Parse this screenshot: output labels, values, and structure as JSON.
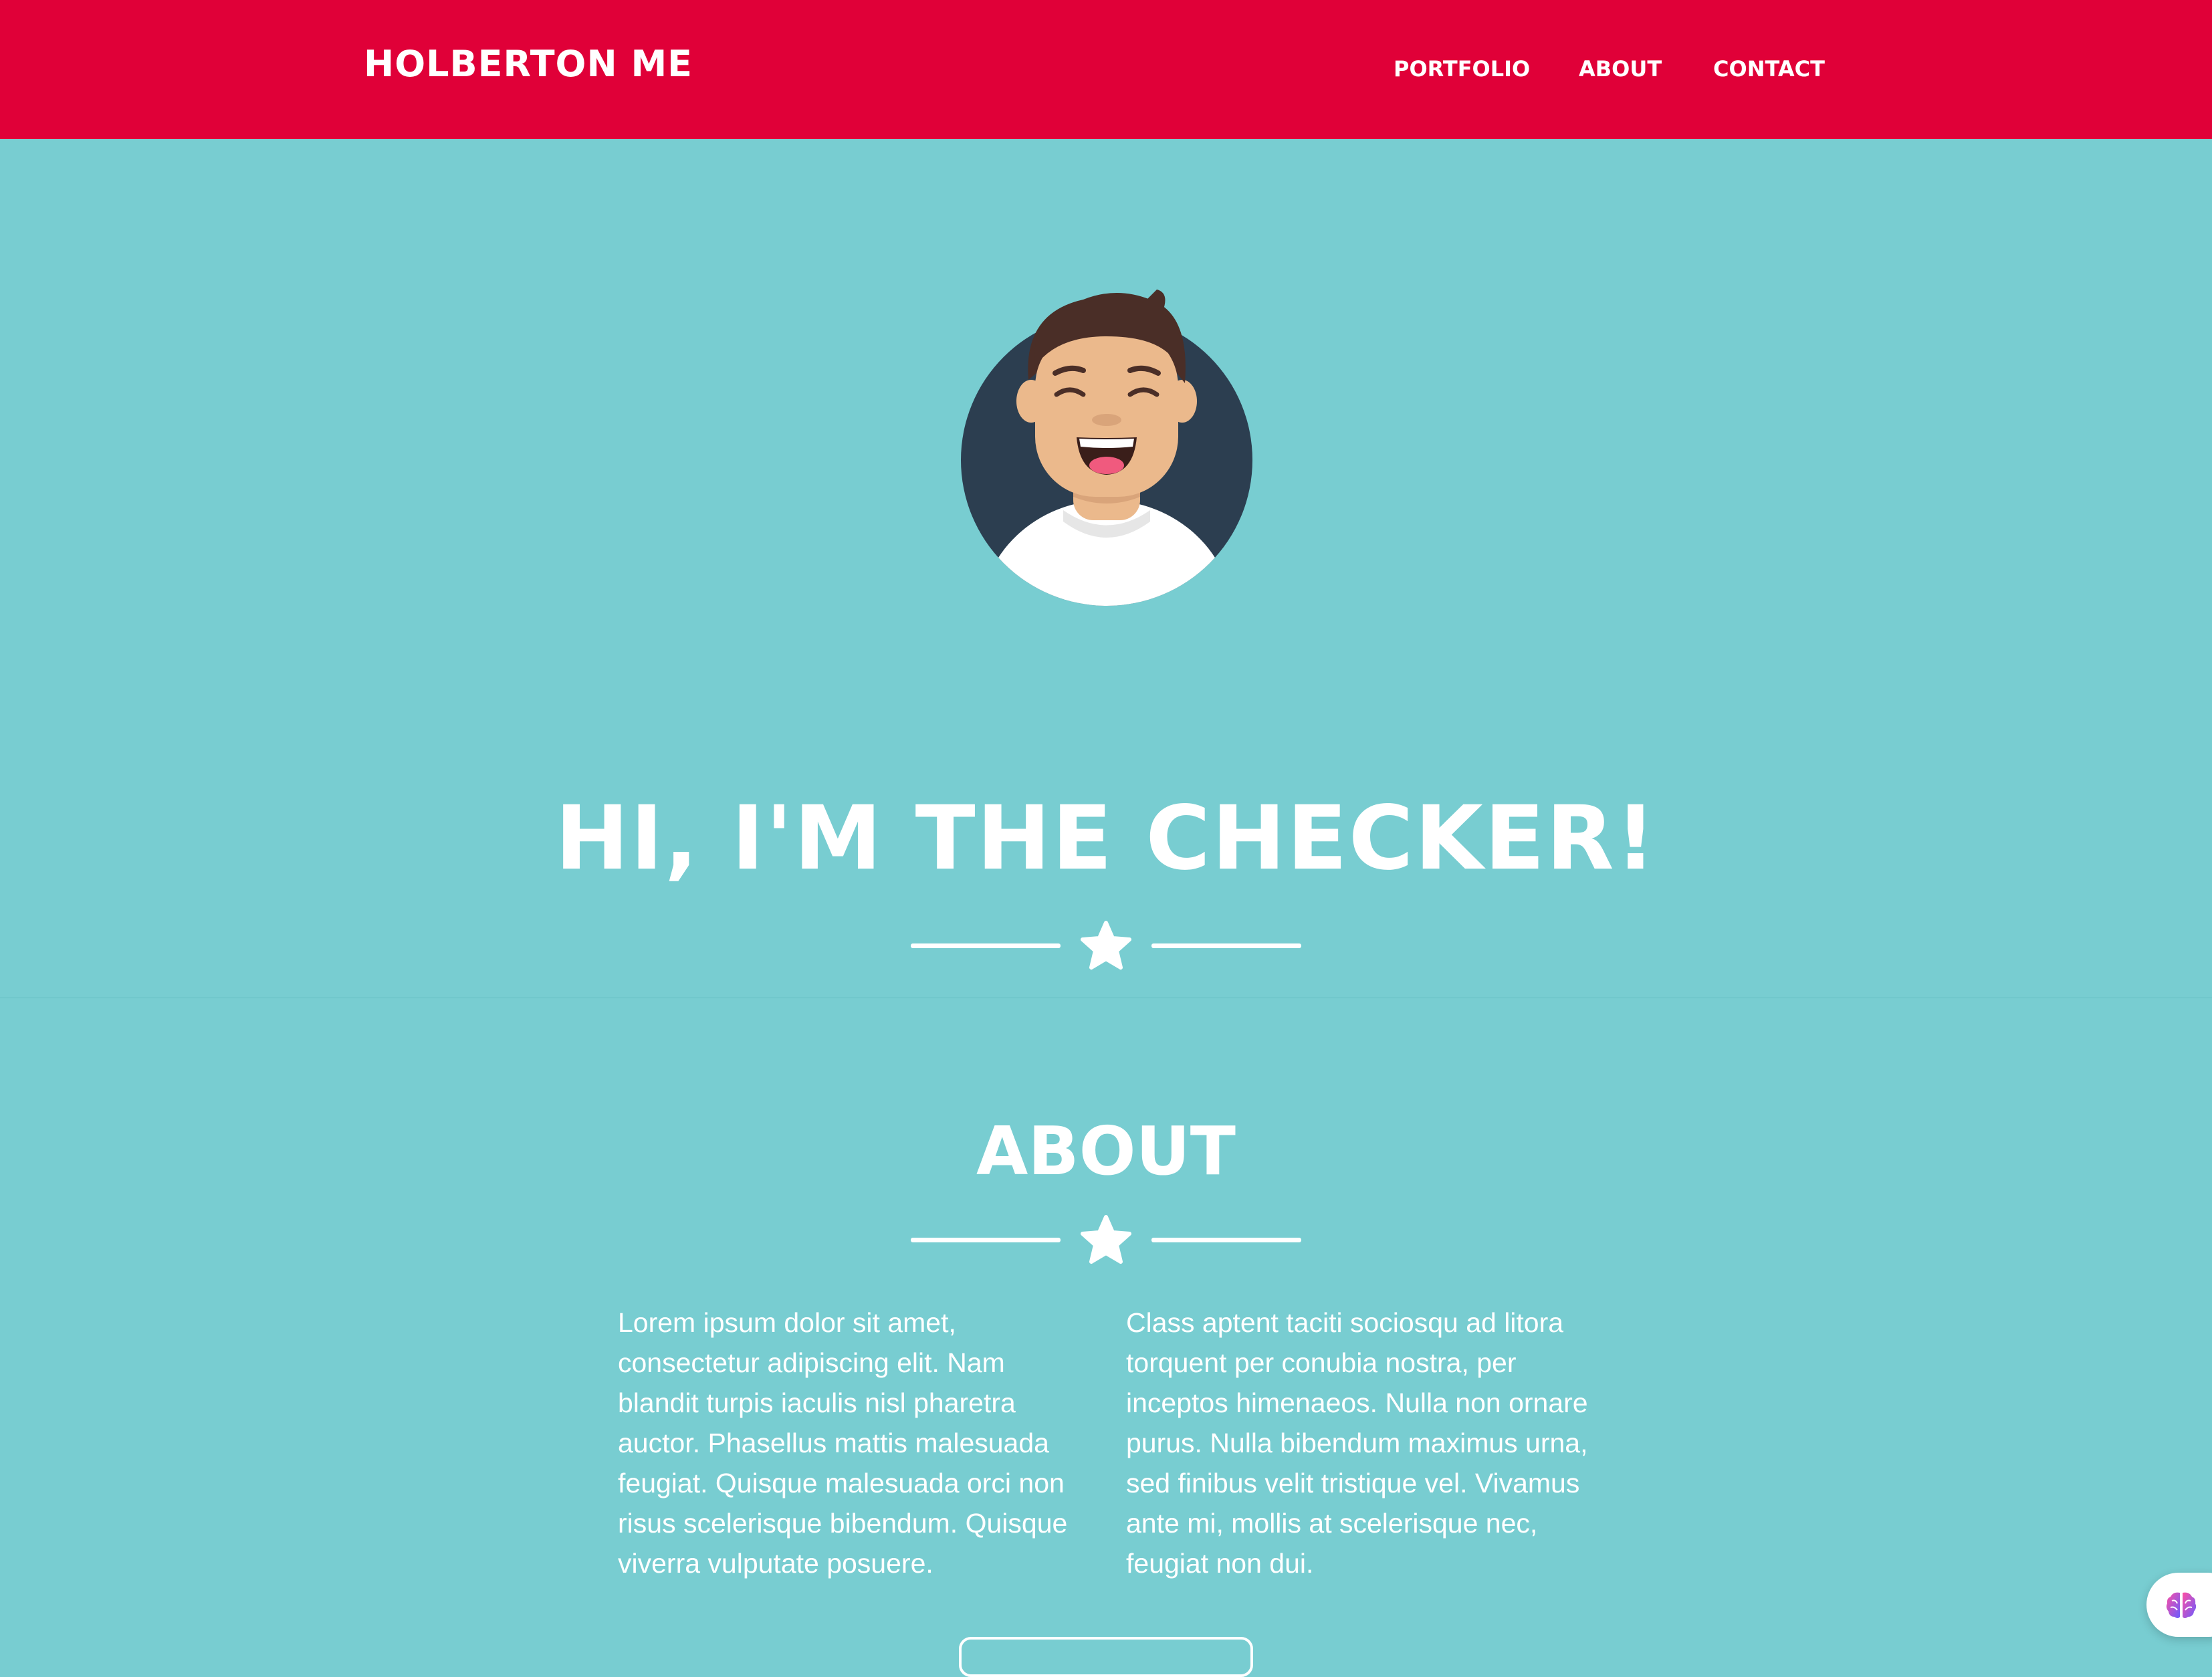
{
  "navbar": {
    "brand": "HOLBERTON ME",
    "links": [
      {
        "label": "PORTFOLIO"
      },
      {
        "label": "ABOUT"
      },
      {
        "label": "CONTACT"
      }
    ]
  },
  "masthead": {
    "avatar_icon": "smiling-person-avatar",
    "title": "HI, I'M THE CHECKER!",
    "divider_icon": "star-icon"
  },
  "about": {
    "title": "ABOUT",
    "divider_icon": "star-icon",
    "left_text": "Lorem ipsum dolor sit amet, consectetur adipiscing elit. Nam blandit turpis iaculis nisl pharetra auctor. Phasellus mattis malesuada feugiat. Quisque malesuada orci non risus scelerisque bibendum. Quisque viverra vulputate posuere.",
    "right_text": "Class aptent taciti sociosqu ad litora torquent per conubia nostra, per inceptos himenaeos. Nulla non ornare purus. Nulla bibendum maximus urna, sed finibus velit tristique vel. Vivamus ante mi, mollis at scelerisque nec, feugiat non dui."
  },
  "colors": {
    "navbar": "#e00038",
    "background": "#78cdd1",
    "text": "#ffffff",
    "avatar_circle": "#2c3e50"
  },
  "widget": {
    "icon": "brain-icon"
  }
}
